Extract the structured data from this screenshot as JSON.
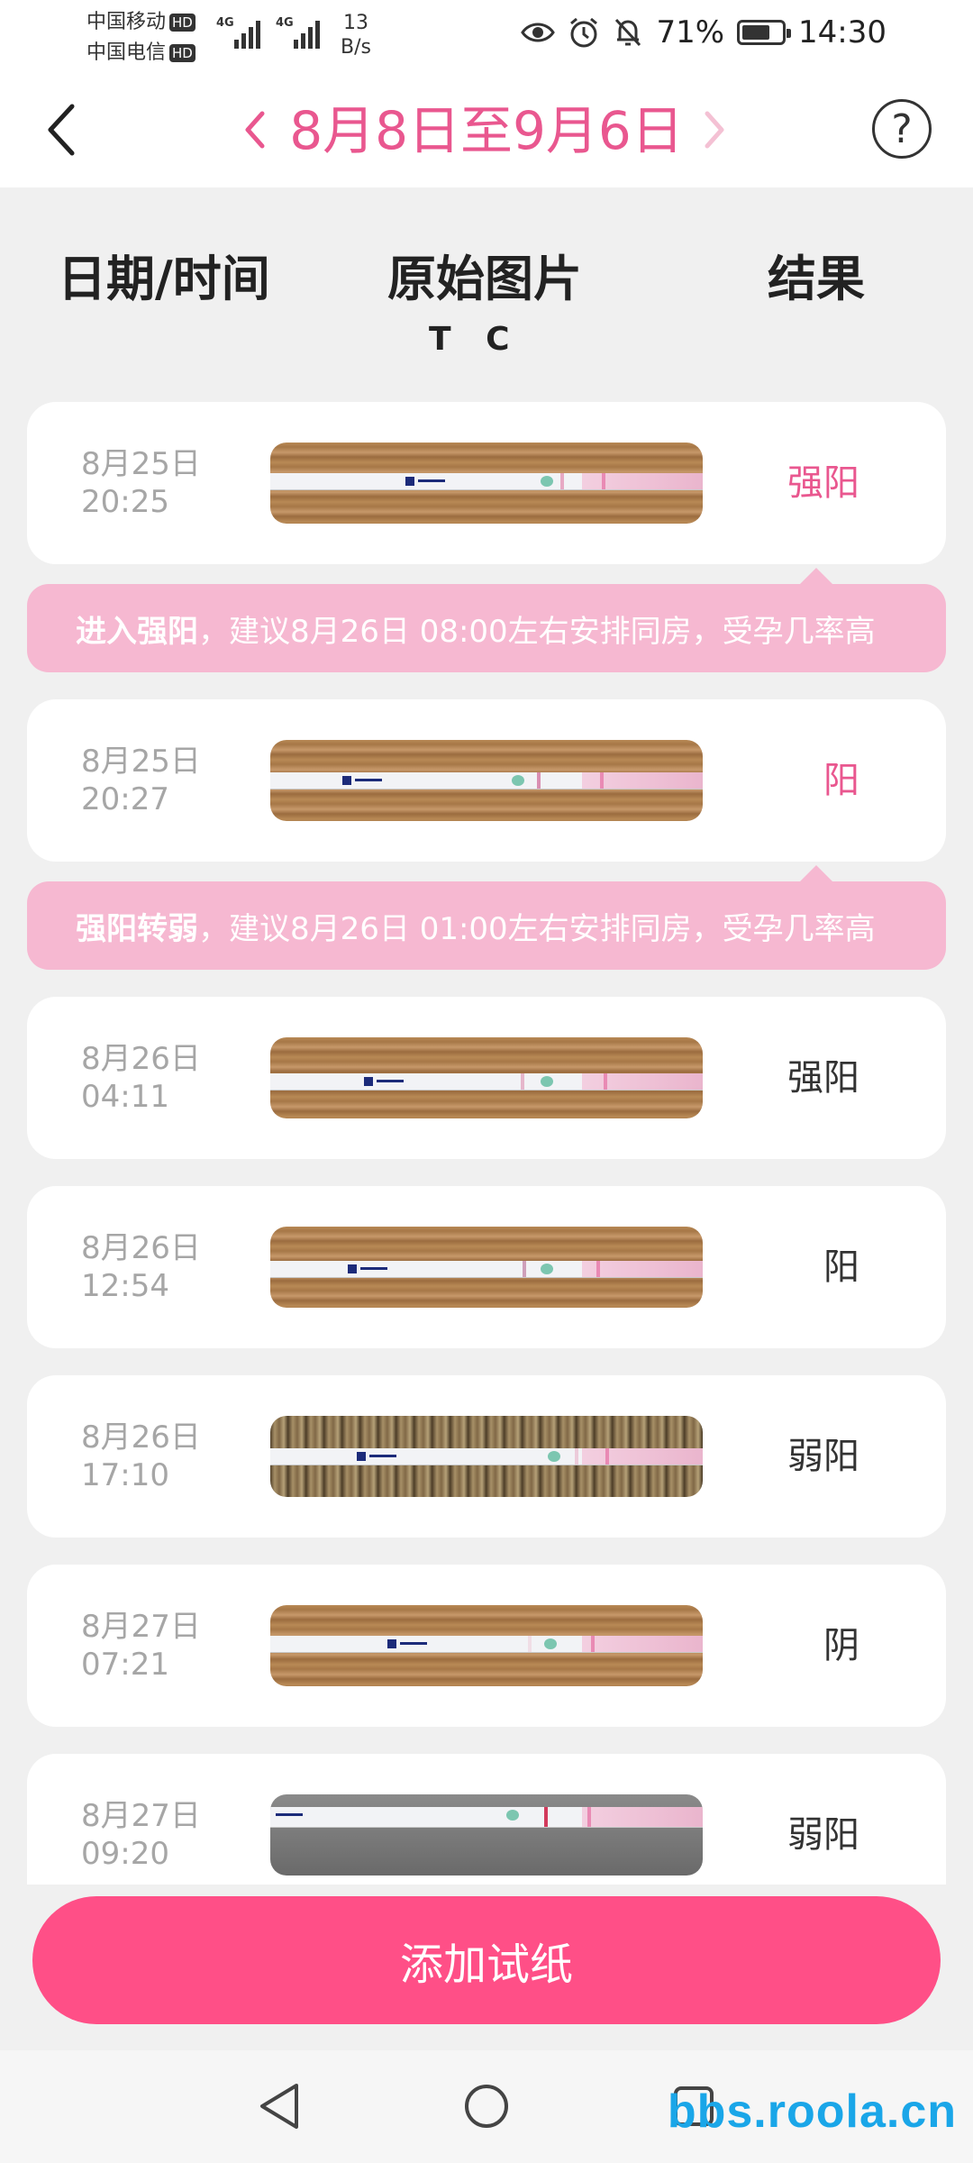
{
  "status_bar": {
    "carrier1": "中国移动",
    "carrier2": "中国电信",
    "hd": "HD",
    "network1": "4G",
    "network2": "4G",
    "speed_value": "13",
    "speed_unit": "B/s",
    "battery": "71%",
    "battery_level": 0.71,
    "time": "14:30",
    "icons": [
      "eye-icon",
      "alarm-icon",
      "bell-off-icon",
      "battery-icon"
    ]
  },
  "header": {
    "date_range": "8月8日至9月6日",
    "help": "?"
  },
  "columns": {
    "datetime": "日期/时间",
    "image": "原始图片",
    "result": "结果",
    "t_label": "T",
    "c_label": "C"
  },
  "records": [
    {
      "date": "8月25日",
      "time": "20:25",
      "result": "强阳",
      "result_color": "#e9578f"
    },
    {
      "date": "8月25日",
      "time": "20:27",
      "result": "阳",
      "result_color": "#e9578f"
    },
    {
      "date": "8月26日",
      "time": "04:11",
      "result": "强阳",
      "result_color": "#333333"
    },
    {
      "date": "8月26日",
      "time": "12:54",
      "result": "阳",
      "result_color": "#333333"
    },
    {
      "date": "8月26日",
      "time": "17:10",
      "result": "弱阳",
      "result_color": "#333333"
    },
    {
      "date": "8月27日",
      "time": "07:21",
      "result": "阴",
      "result_color": "#333333"
    },
    {
      "date": "8月27日",
      "time": "09:20",
      "result": "弱阳",
      "result_color": "#333333"
    }
  ],
  "tips": [
    {
      "strong": "进入强阳",
      "text": "，建议8月26日 08:00左右安排同房，受孕几率高"
    },
    {
      "strong": "强阳转弱",
      "text": "，建议8月26日 01:00左右安排同房，受孕几率高"
    }
  ],
  "add_button": "添加试纸",
  "watermark": "bbs.roola.cn",
  "colors": {
    "accent": "#e9578f",
    "button": "#ff4f87",
    "tip_bg": "#f6b8d1",
    "date_text": "#a6a6a6"
  }
}
